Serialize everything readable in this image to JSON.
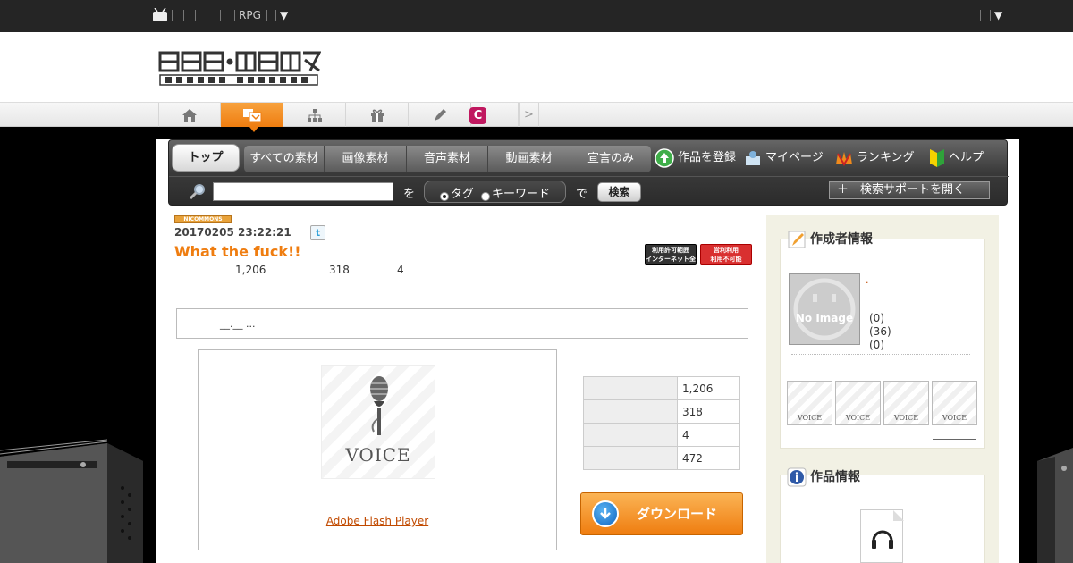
{
  "topbar": {
    "rpg_label": "RPG",
    "arrow": "▼",
    "right_arrow": "▼"
  },
  "nav": {
    "next": ">"
  },
  "commons_menu": {
    "top": "トップ",
    "tabs": [
      "すべての素材",
      "画像素材",
      "音声素材",
      "動画素材",
      "宣言のみ"
    ],
    "register": "作品を登録",
    "mypage": "マイページ",
    "ranking": "ランキング",
    "help": "ヘルプ",
    "search_placeholder": "",
    "wo": "を",
    "radio_tag": "タグ",
    "radio_keyword": "キーワード",
    "de": "で",
    "search_button": "検索",
    "support_button": "＋　検索サポートを開く"
  },
  "work": {
    "badge": "NICOMMONS",
    "date": "20170205 23:22:21",
    "twitter": "t",
    "title": "What the fuck!!",
    "views": "1,206",
    "plays": "318",
    "comments": "4",
    "license_1": [
      "利用許可範囲",
      "インターネット全般"
    ],
    "license_2": [
      "営利利用",
      "利用不可能"
    ],
    "description": "__.__ ..."
  },
  "player": {
    "thumb_label": "VOICE",
    "flash_link": "Adobe Flash Player"
  },
  "stats": {
    "rows": [
      {
        "value": "1,206"
      },
      {
        "value": "318"
      },
      {
        "value": "4"
      },
      {
        "value": "472"
      }
    ]
  },
  "download": {
    "label": "ダウンロード"
  },
  "creator": {
    "heading": "作成者情報",
    "name": ".",
    "no_image": "No Image",
    "counts": [
      "(0)",
      "(36)",
      "(0)"
    ],
    "mini_label": "VOICE"
  },
  "work_info": {
    "heading": "作品情報"
  }
}
